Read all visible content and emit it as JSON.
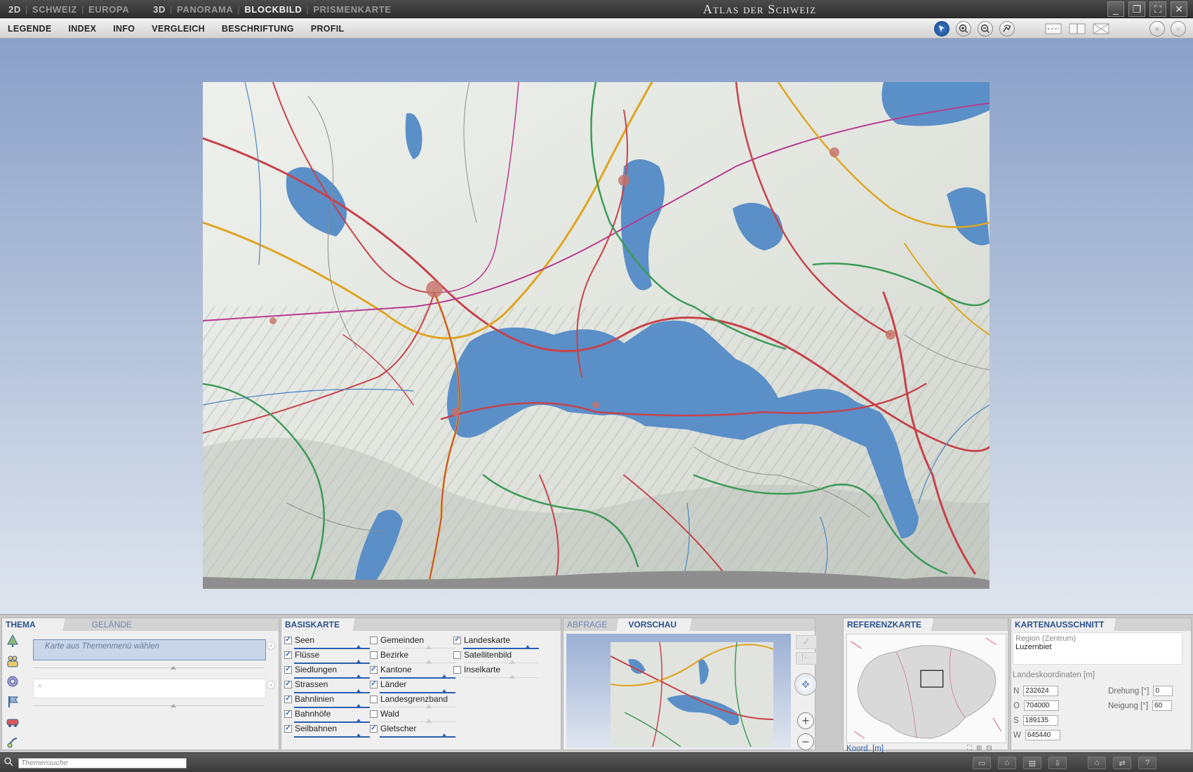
{
  "app": {
    "title": "Atlas der Schweiz"
  },
  "modes": {
    "m2d": "2D",
    "schweiz": "SCHWEIZ",
    "europa": "EUROPA",
    "m3d": "3D",
    "panorama": "PANORAMA",
    "blockbild": "BLOCKBILD",
    "prismenkarte": "PRISMENKARTE",
    "active": "BLOCKBILD"
  },
  "menu": {
    "legende": "LEGENDE",
    "index": "INDEX",
    "info": "INFO",
    "vergleich": "VERGLEICH",
    "beschriftung": "BESCHRIFTUNG",
    "profil": "PROFIL"
  },
  "toolbar_icons": [
    "select-pointer-icon",
    "zoom-in-icon",
    "zoom-out-icon",
    "tilt-icon",
    "dashed-line-icon",
    "split-view-icon",
    "close-map-icon",
    "collapse-left-icon",
    "expand-right-icon"
  ],
  "thema": {
    "tab_thema": "THEMA",
    "tab_gelaende": "GELÄNDE",
    "select_placeholder": "Karte aus Themenmenü wählen",
    "icons": [
      "tree-icon",
      "people-icon",
      "economy-icon",
      "flag-icon",
      "transport-icon",
      "communication-icon"
    ]
  },
  "basiskarte": {
    "title": "BASISKARTE",
    "col1": [
      {
        "label": "Seen",
        "checked": "✓"
      },
      {
        "label": "Flüsse",
        "checked": "✓"
      },
      {
        "label": "Siedlungen",
        "checked": "✓"
      },
      {
        "label": "Strassen",
        "checked": "✓"
      },
      {
        "label": "Bahnlinien",
        "checked": "✓"
      },
      {
        "label": "Bahnhöfe",
        "checked": "✓"
      },
      {
        "label": "Seilbahnen",
        "checked": "✓"
      }
    ],
    "col2": [
      {
        "label": "Gemeinden",
        "checked": ""
      },
      {
        "label": "Bezirke",
        "checked": ""
      },
      {
        "label": "Kantone",
        "checked": "✓"
      },
      {
        "label": "Länder",
        "checked": "✓"
      },
      {
        "label": "Landesgrenzband",
        "checked": ""
      },
      {
        "label": "Wald",
        "checked": ""
      },
      {
        "label": "Gletscher",
        "checked": "✓"
      }
    ],
    "col3": [
      {
        "label": "Landeskarte",
        "checked": "✓"
      },
      {
        "label": "Satellitenbild",
        "checked": ""
      },
      {
        "label": "Inselkarte",
        "checked": ""
      }
    ]
  },
  "abfrage": {
    "tab_abfrage": "ABFRAGE",
    "tab_vorschau": "VORSCHAU"
  },
  "referenzkarte": {
    "title": "REFERENZKARTE",
    "koord_label": "Koord. [m]"
  },
  "kartenausschnitt": {
    "title": "KARTENAUSSCHNITT",
    "region_label": "Region (Zentrum)",
    "region_value": "Luzernbiet",
    "lk_title": "Landeskoordinaten [m]",
    "n_label": "N",
    "n_value": "232624",
    "o_label": "O",
    "o_value": "704000",
    "s_label": "S",
    "s_value": "189135",
    "w_label": "W",
    "w_value": "645440",
    "drehung_label": "Drehung [°]",
    "drehung_value": "0",
    "neigung_label": "Neigung [°]",
    "neigung_value": "60"
  },
  "statusbar": {
    "search_placeholder": "Themensuche"
  }
}
